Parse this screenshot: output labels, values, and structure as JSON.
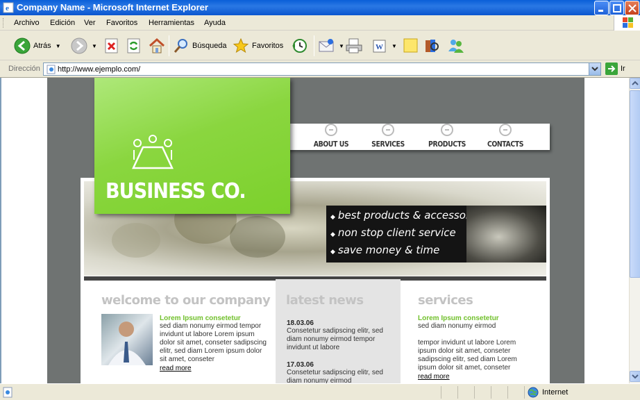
{
  "window": {
    "title": "Company Name - Microsoft Internet Explorer"
  },
  "menu": {
    "items": [
      "Archivo",
      "Edición",
      "Ver",
      "Favoritos",
      "Herramientas",
      "Ayuda"
    ]
  },
  "toolbar": {
    "back_label": "Atrás",
    "search_label": "Búsqueda",
    "favorites_label": "Favoritos"
  },
  "address": {
    "label": "Dirección",
    "url": "http://www.ejemplo.com/",
    "go_label": "Ir"
  },
  "site": {
    "nav": [
      "ABOUT US",
      "SERVICES",
      "PRODUCTS",
      "CONTACTS"
    ],
    "logo_title": "BUSINESS CO.",
    "taglines": [
      "best products & accessories",
      "non stop client service",
      "save money & time"
    ],
    "welcome": {
      "heading": "welcome to our company",
      "title": "Lorem Ipsum consetetur",
      "text": "sed diam nonumy eirmod tempor invidunt ut labore Lorem ipsum dolor sit amet, conseter sadipscing elitr, sed diam Lorem ipsum dolor sit amet, conseter",
      "read_more": "read more"
    },
    "news": {
      "heading": "latest news",
      "items": [
        {
          "date": "18.03.06",
          "text": "Consetetur sadipscing elitr, sed diam nonumy eirmod tempor invidunt ut labore"
        },
        {
          "date": "17.03.06",
          "text": "Consetetur sadipscing elitr, sed diam nonumy eirmod"
        }
      ]
    },
    "services": {
      "heading": "services",
      "title": "Lorem Ipsum consetetur",
      "subtitle": "sed diam nonumy eirmod",
      "text": "tempor invidunt ut labore Lorem ipsum dolor sit amet, conseter sadipscing elitr, sed diam Lorem ipsum dolor sit amet, conseter",
      "read_more": "read more"
    }
  },
  "status": {
    "zone": "Internet"
  },
  "colors": {
    "titlebar": "#0a5fd8",
    "green": "#7cd12c",
    "page_bg": "#6f7372"
  }
}
